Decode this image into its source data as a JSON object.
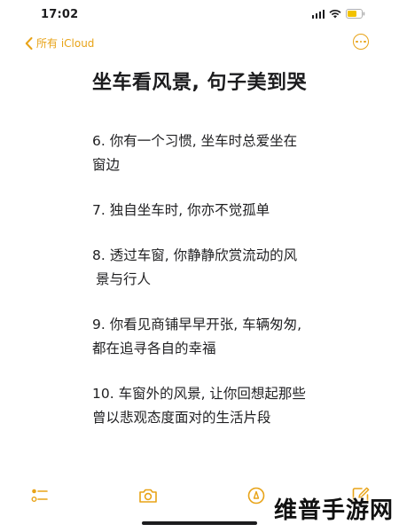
{
  "status_bar": {
    "time": "17:02"
  },
  "nav": {
    "back_label": "所有 iCloud"
  },
  "note": {
    "title": "坐车看风景, 句子美到哭",
    "items": [
      {
        "lines": [
          "6. 你有一个习惯, 坐车时总爱坐在",
          "窗边"
        ]
      },
      {
        "lines": [
          "7. 独自坐车时, 你亦不觉孤单"
        ]
      },
      {
        "lines": [
          "8. 透过车窗, 你静静欣赏流动的风",
          "景与行人"
        ]
      },
      {
        "lines": [
          "9. 你看见商铺早早开张, 车辆匆匆,",
          "都在追寻各自的幸福"
        ]
      },
      {
        "lines": [
          "10. 车窗外的风景, 让你回想起那些",
          "曾以悲观态度面对的生活片段"
        ]
      }
    ]
  },
  "toolbar": {
    "tools": [
      "checklist-icon",
      "camera-icon",
      "markup-icon",
      "compose-icon"
    ]
  },
  "watermark": "维普手游网",
  "colors": {
    "accent": "#e8a317",
    "text": "#1c1c1e",
    "background": "#ffffff"
  }
}
